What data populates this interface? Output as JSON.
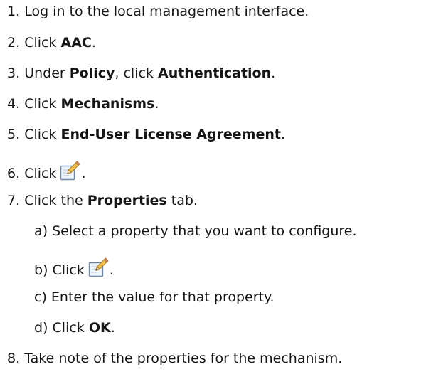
{
  "steps": [
    {
      "num": "1.",
      "text": "Log in to the local management interface."
    },
    {
      "num": "2.",
      "pre": "Click ",
      "bold": "AAC",
      "post": "."
    },
    {
      "num": "3.",
      "pre": "Under ",
      "bold": "Policy",
      "mid": ", click ",
      "bold2": "Authentication",
      "post": "."
    },
    {
      "num": "4.",
      "pre": "Click ",
      "bold": "Mechanisms",
      "post": "."
    },
    {
      "num": "5.",
      "pre": "Click ",
      "bold": "End-User License Agreement",
      "post": "."
    },
    {
      "num": "6.",
      "pre": "Click",
      "post": ".",
      "icon": "edit-icon"
    },
    {
      "num": "7.",
      "pre": "Click the ",
      "bold": "Properties",
      "post": " tab."
    },
    {
      "num": "8.",
      "text": "Take note of the properties for the mechanism."
    }
  ],
  "substeps": [
    {
      "num": "a)",
      "text": "Select a property that you want to configure."
    },
    {
      "num": "b)",
      "pre": "Click",
      "post": ".",
      "icon": "edit-icon"
    },
    {
      "num": "c)",
      "text": "Enter the value for that property."
    },
    {
      "num": "d)",
      "pre": "Click ",
      "bold": "OK",
      "post": "."
    }
  ]
}
